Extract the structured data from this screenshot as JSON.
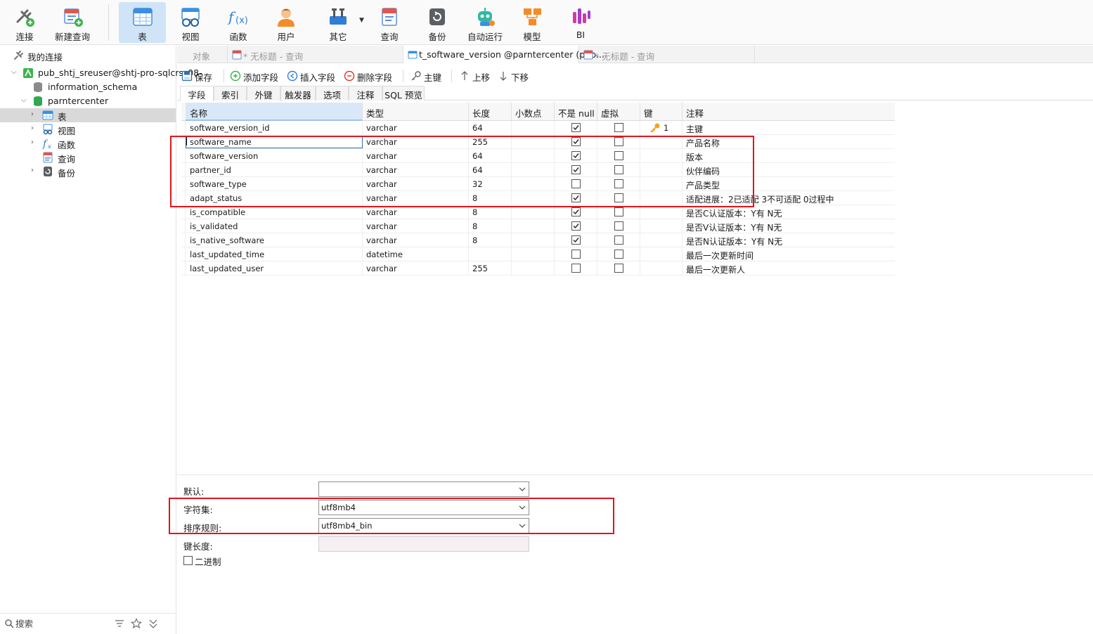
{
  "toolbar": {
    "items": [
      {
        "label": "连接",
        "icon": "connect-icon"
      },
      {
        "label": "新建查询",
        "icon": "new-query-icon"
      },
      {
        "label": "表",
        "icon": "table-icon"
      },
      {
        "label": "视图",
        "icon": "view-icon"
      },
      {
        "label": "函数",
        "icon": "function-icon"
      },
      {
        "label": "用户",
        "icon": "user-icon"
      },
      {
        "label": "其它",
        "icon": "tools-icon"
      },
      {
        "label": "查询",
        "icon": "query-icon"
      },
      {
        "label": "备份",
        "icon": "backup-icon"
      },
      {
        "label": "自动运行",
        "icon": "robot-icon"
      },
      {
        "label": "模型",
        "icon": "model-icon"
      },
      {
        "label": "BI",
        "icon": "bi-icon"
      }
    ],
    "active": "表"
  },
  "sidebar": {
    "header": "我的连接",
    "connection": "pub_shtj_sreuser@shtj-pro-sqlcrs_08-",
    "databases": [
      "information_schema",
      "parntercenter"
    ],
    "children": [
      "表",
      "视图",
      "函数",
      "查询",
      "备份"
    ],
    "search_placeholder": "搜索"
  },
  "doc_tabs": {
    "objects": "对象",
    "tab1": "* 无标题 - 查询",
    "tab2": "t_software_version @parntercenter (pub...",
    "tab3": "* 无标题 - 查询"
  },
  "actions": {
    "save": "保存",
    "add_field": "添加字段",
    "insert_field": "插入字段",
    "delete_field": "删除字段",
    "primary_key": "主键",
    "move_up": "上移",
    "move_down": "下移"
  },
  "sub_tabs": [
    "字段",
    "索引",
    "外键",
    "触发器",
    "选项",
    "注释",
    "SQL 预览"
  ],
  "grid": {
    "headers": {
      "name": "名称",
      "type": "类型",
      "length": "长度",
      "decimal": "小数点",
      "not_null": "不是 null",
      "virtual": "虚拟",
      "key": "键",
      "comment": "注释"
    },
    "rows": [
      {
        "name": "software_version_id",
        "type": "varchar",
        "length": "64",
        "not_null": true,
        "virtual": false,
        "key": "1",
        "comment": "主键"
      },
      {
        "name": "software_name",
        "type": "varchar",
        "length": "255",
        "not_null": true,
        "virtual": false,
        "key": "",
        "comment": "产品名称"
      },
      {
        "name": "software_version",
        "type": "varchar",
        "length": "64",
        "not_null": true,
        "virtual": false,
        "key": "",
        "comment": "版本"
      },
      {
        "name": "partner_id",
        "type": "varchar",
        "length": "64",
        "not_null": true,
        "virtual": false,
        "key": "",
        "comment": "伙伴编码"
      },
      {
        "name": "software_type",
        "type": "varchar",
        "length": "32",
        "not_null": false,
        "virtual": false,
        "key": "",
        "comment": "产品类型"
      },
      {
        "name": "adapt_status",
        "type": "varchar",
        "length": "8",
        "not_null": true,
        "virtual": false,
        "key": "",
        "comment": "适配进展：2已适配 3不可适配 0过程中"
      },
      {
        "name": "is_compatible",
        "type": "varchar",
        "length": "8",
        "not_null": true,
        "virtual": false,
        "key": "",
        "comment": "是否C认证版本：Y有 N无"
      },
      {
        "name": "is_validated",
        "type": "varchar",
        "length": "8",
        "not_null": true,
        "virtual": false,
        "key": "",
        "comment": "是否V认证版本：Y有 N无"
      },
      {
        "name": "is_native_software",
        "type": "varchar",
        "length": "8",
        "not_null": true,
        "virtual": false,
        "key": "",
        "comment": "是否N认证版本：Y有 N无"
      },
      {
        "name": "last_updated_time",
        "type": "datetime",
        "length": "",
        "not_null": false,
        "virtual": false,
        "key": "",
        "comment": "最后一次更新时间"
      },
      {
        "name": "last_updated_user",
        "type": "varchar",
        "length": "255",
        "not_null": false,
        "virtual": false,
        "key": "",
        "comment": "最后一次更新人"
      }
    ]
  },
  "props": {
    "default_label": "默认:",
    "default_value": "",
    "charset_label": "字符集:",
    "charset_value": "utf8mb4",
    "collation_label": "排序规则:",
    "collation_value": "utf8mb4_bin",
    "key_length_label": "键长度:",
    "binary_label": "二进制",
    "binary_checked": false
  }
}
